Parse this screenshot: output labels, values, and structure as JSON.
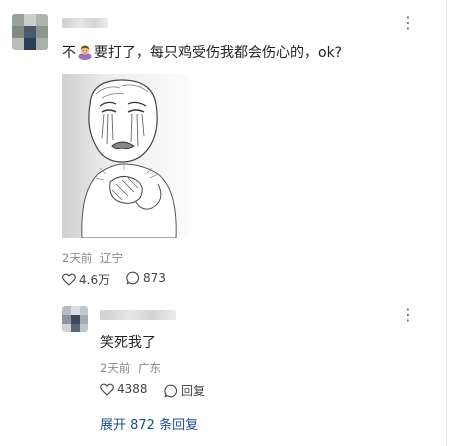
{
  "comment": {
    "text_prefix": "不",
    "text_suffix": "要打了，每只鸡受伤我都会伤心的，ok?",
    "time": "2天前",
    "location": "辽宁",
    "like_count": "4.6万",
    "reply_count": "873"
  },
  "reply": {
    "text": "笑死我了",
    "time": "2天前",
    "location": "广东",
    "like_count": "4388",
    "reply_label": "回复"
  },
  "expand_label": "展开 872 条回复",
  "colors": {
    "link": "#1f4e8c",
    "meta": "#8a8a8a"
  }
}
